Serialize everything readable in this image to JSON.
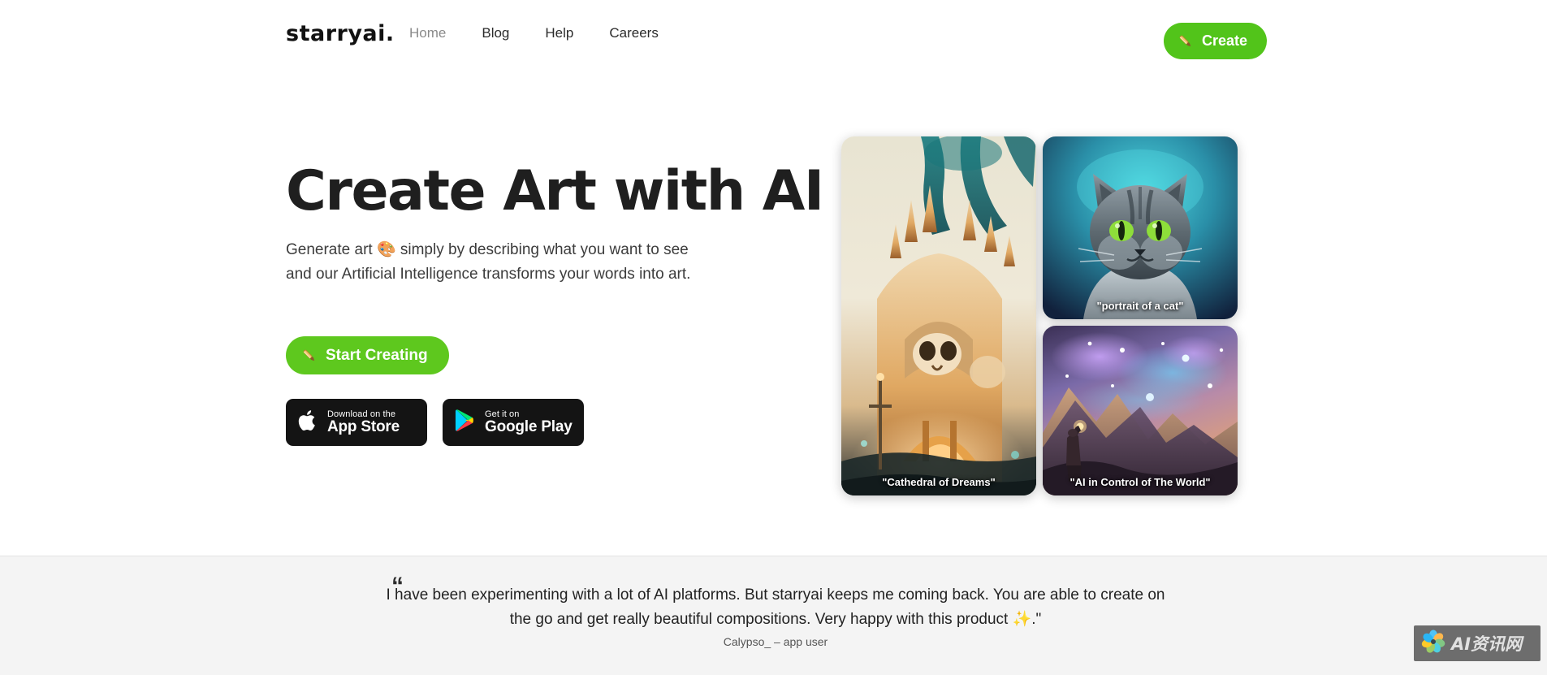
{
  "header": {
    "logo": "starryai",
    "logo_dot": ".",
    "nav": [
      {
        "label": "Home",
        "active": true
      },
      {
        "label": "Blog",
        "active": false
      },
      {
        "label": "Help",
        "active": false
      },
      {
        "label": "Careers",
        "active": false
      }
    ],
    "create_button": {
      "label": "Create",
      "icon": "paintbrush-icon",
      "color": "#52c41a"
    }
  },
  "hero": {
    "headline": "Create Art with AI",
    "subtext_line1": "Generate art 🎨 simply by describing what you want to see",
    "subtext_line2": "and our Artificial Intelligence transforms your words into art.",
    "start_button": {
      "label": "Start Creating",
      "icon": "paintbrush-icon",
      "color": "#5ec81e"
    },
    "store_badges": [
      {
        "small": "Download on the",
        "big": "App Store",
        "icon": "apple-icon"
      },
      {
        "small": "Get it on",
        "big": "Google Play",
        "icon": "google-play-icon"
      }
    ],
    "cards": [
      {
        "caption": "\"Cathedral of Dreams\"",
        "name": "card-cathedral-of-dreams"
      },
      {
        "caption": "\"portrait of a cat\"",
        "name": "card-portrait-of-a-cat"
      },
      {
        "caption": "\"AI in Control of The World\"",
        "name": "card-ai-in-control-of-the-world"
      }
    ]
  },
  "testimonial": {
    "quote_mark": "❞",
    "text": "I have been experimenting with a lot of AI platforms. But starryai keeps me coming back. You are able to create on the go and get really beautiful compositions. Very happy with this product ✨.\"",
    "author": "Calypso_ – app user"
  },
  "watermark": {
    "text": "AI资讯网",
    "icon": "flower-pinwheel-logo"
  },
  "colors": {
    "brand_green": "#52c41a",
    "page_bg": "#ffffff",
    "testimonial_bg": "#f4f4f4",
    "text_dark": "#1f1f1f"
  }
}
